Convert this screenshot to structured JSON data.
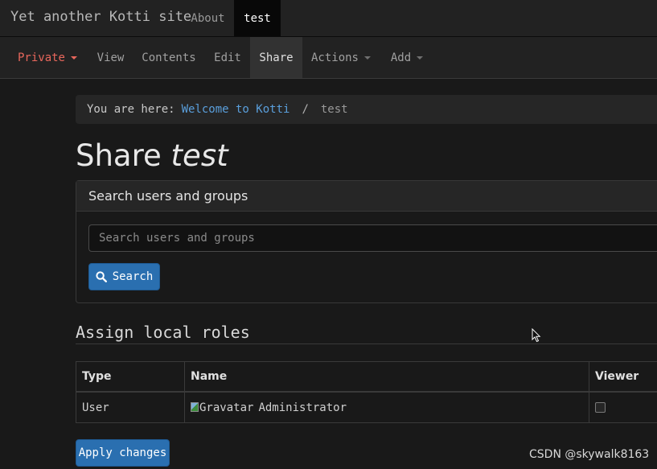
{
  "site": {
    "brand": "Yet another Kotti site",
    "nav": [
      {
        "label": "About"
      },
      {
        "label": "test"
      }
    ]
  },
  "editbar": {
    "state_label": "Private",
    "items": [
      "View",
      "Contents",
      "Edit",
      "Share"
    ],
    "actions_label": "Actions",
    "add_label": "Add"
  },
  "breadcrumb": {
    "prefix": "You are here:",
    "home": "Welcome to Kotti",
    "separator": "/",
    "current": "test"
  },
  "title": {
    "prefix": "Share",
    "name": "test"
  },
  "search": {
    "heading": "Search users and groups",
    "placeholder": "Search users and groups",
    "button": "Search"
  },
  "roles": {
    "heading": "Assign local roles",
    "columns": [
      "Type",
      "Name",
      "Viewer"
    ],
    "rows": [
      {
        "type": "User",
        "avatar_alt": "Gravatar",
        "name": "Administrator",
        "viewer": false
      }
    ],
    "apply_button": "Apply changes"
  },
  "watermark": "CSDN @skywalk8163",
  "colors": {
    "primary_button": "#2a6fb0",
    "private_state": "#e8675c",
    "link": "#5a9fdc"
  }
}
